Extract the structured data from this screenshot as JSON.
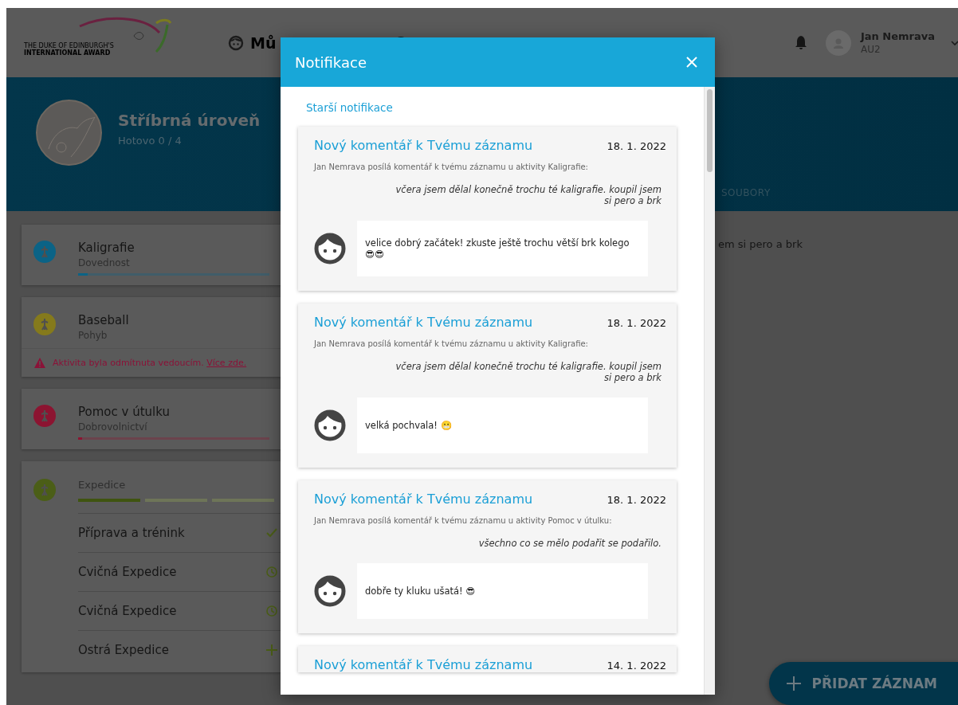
{
  "header": {
    "logo_lines": [
      "THE DUKE OF EDINBURGH'S",
      "INTERNATIONAL AWARD"
    ],
    "nav": [
      {
        "label": "Mů"
      }
    ],
    "user": {
      "name": "Jan Nemrava",
      "role": "AU2"
    }
  },
  "banner": {
    "title": "Stříbrná úroveň",
    "subtitle": "Hotovo 0 / 4",
    "tab": "SOUBORY"
  },
  "activities": [
    {
      "name": "Kaligrafie",
      "category": "Dovednost",
      "color": "#0b6386",
      "level": 0.05
    },
    {
      "name": "Baseball",
      "category": "Pohyb",
      "color": "#857a1c",
      "warning": "Aktivita byla odmítnuta vedoucím.",
      "warning_link": "Více zde."
    },
    {
      "name": "Pomoc v útulku",
      "category": "Dobrovolnictví",
      "color": "#8c1431",
      "level": 0.02
    }
  ],
  "expedition": {
    "name": "Expedice",
    "color": "#4b5e17",
    "segments": [
      true,
      false,
      false
    ],
    "steps": [
      {
        "label": "Příprava a trénink",
        "kind": "done"
      },
      {
        "label": "Cvičná Expedice",
        "kind": "pending"
      },
      {
        "label": "Cvičná Expedice",
        "kind": "pending"
      },
      {
        "label": "Ostrá Expedice",
        "kind": "add"
      }
    ]
  },
  "record_excerpt": "em si pero a brk",
  "add_button": {
    "label": "PŘIDAT ZÁZNAM"
  },
  "modal": {
    "title": "Notifikace",
    "older_link": "Starší notifikace",
    "notifications": [
      {
        "title": "Nový komentář k Tvému záznamu",
        "date": "18. 1. 2022",
        "intro": "Jan Nemrava posílá komentář k tvému záznamu u aktivity Kaligrafie:",
        "quote": "včera jsem dělal konečně trochu té kaligrafie. koupil jsem si pero a brk",
        "comment": "velice dobrý začátek! zkuste ještě trochu větší brk kolego 😎😎"
      },
      {
        "title": "Nový komentář k Tvému záznamu",
        "date": "18. 1. 2022",
        "intro": "Jan Nemrava posílá komentář k tvému záznamu u aktivity Kaligrafie:",
        "quote": "včera jsem dělal konečně trochu té kaligrafie. koupil jsem si pero a brk",
        "comment": "velká pochvala! 😬"
      },
      {
        "title": "Nový komentář k Tvému záznamu",
        "date": "18. 1. 2022",
        "intro": "Jan Nemrava posílá komentář k tvému záznamu u aktivity Pomoc v útulku:",
        "quote": "všechno co se mělo podařit se podařilo.",
        "comment": "dobře ty kluku ušatá! 😎"
      },
      {
        "title": "Nový komentář k Tvému záznamu",
        "date": "14. 1. 2022"
      }
    ]
  }
}
